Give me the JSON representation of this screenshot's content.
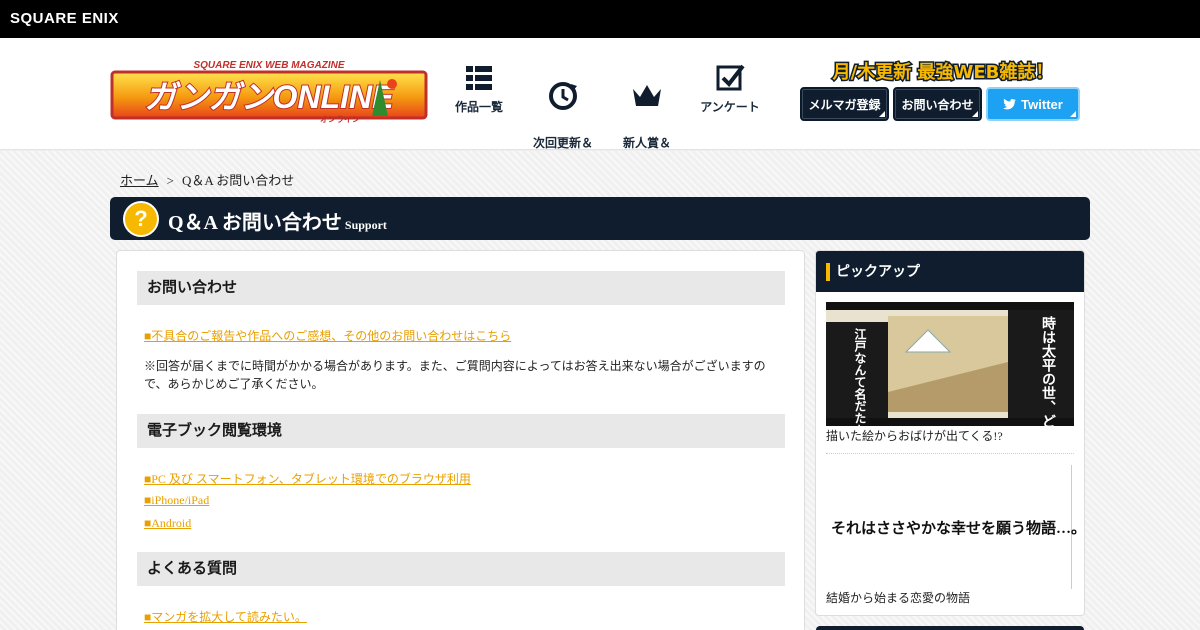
{
  "topbar": {
    "brand": "SQUARE ENIX"
  },
  "header": {
    "logo": {
      "subtitle": "SQUARE ENIX WEB MAGAZINE",
      "main": "ガンガンONLINE",
      "ruby": "オンライン"
    },
    "nav": [
      {
        "label": "作品一覧",
        "icon": "grid-list-icon"
      },
      {
        "label": "次回更新＆\n履歴",
        "icon": "history-clock-icon"
      },
      {
        "label": "新人賞＆\n持ち込み",
        "icon": "crown-icon"
      },
      {
        "label": "アンケート",
        "icon": "checkbox-icon"
      }
    ],
    "tagline": "月/木更新 最強WEB雑誌！",
    "buttons": {
      "mail": "メルマガ登録",
      "contact": "お問い合わせ",
      "twitter": "Twitter"
    }
  },
  "breadcrumb": {
    "home": "ホーム",
    "separator": ">",
    "current": "Q＆A お問い合わせ"
  },
  "page": {
    "title": "Q＆A お問い合わせ",
    "subtitle": "Support",
    "icon": "question-mark-icon"
  },
  "main": {
    "section1": {
      "heading": "お問い合わせ",
      "link": "■不具合のご報告や作品へのご感想、その他のお問い合わせはこちら",
      "note": "※回答が届くまでに時間がかかる場合があります。また、ご質問内容によってはお答え出来ない場合がございますので、あらかじめご了承ください。"
    },
    "section2": {
      "heading": "電子ブック閲覧環境",
      "links": [
        "■PC 及び スマートフォン、タブレット環境でのブラウザ利用",
        "■iPhone/iPad",
        "■Android"
      ]
    },
    "section3": {
      "heading": "よくある質問",
      "links": [
        "■マンガを拡大して読みたい。"
      ]
    }
  },
  "sidebar": {
    "heading": "ピックアップ",
    "items": [
      {
        "banner_text_left": "江戸なんて名だたかもしれません",
        "banner_text_right": "時は太平の世、ど真ん中",
        "caption": "描いた絵からおばけが出てくる!?"
      },
      {
        "banner_text": "それはささやかな幸せを願う物語…。",
        "caption": "結婚から始まる恋愛の物語"
      }
    ]
  },
  "colors": {
    "navy": "#0f1d2e",
    "accent": "#f6b800",
    "link": "#e8a000",
    "twitter": "#1da1f2"
  }
}
